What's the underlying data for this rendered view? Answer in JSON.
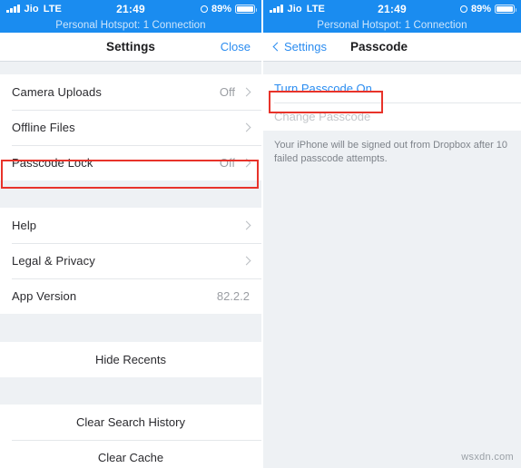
{
  "status_bar": {
    "carrier": "Jio",
    "network": "LTE",
    "time": "21:49",
    "battery_percent": "89%",
    "hotspot_text": "Personal Hotspot: 1 Connection",
    "background_color": "#1a8cf0",
    "icons": {
      "signal": "signal-bars-icon",
      "alarm": "alarm-clock-icon",
      "battery": "battery-icon"
    }
  },
  "left_panel": {
    "nav": {
      "title": "Settings",
      "action_label": "Close"
    },
    "groups": [
      {
        "name": "storage-group",
        "rows": [
          {
            "label": "Camera Uploads",
            "value": "Off",
            "chevron": true
          },
          {
            "label": "Offline Files",
            "value": "",
            "chevron": true
          },
          {
            "label": "Passcode Lock",
            "value": "Off",
            "chevron": true,
            "highlighted": true
          }
        ]
      },
      {
        "name": "info-group",
        "rows": [
          {
            "label": "Help",
            "value": "",
            "chevron": true
          },
          {
            "label": "Legal & Privacy",
            "value": "",
            "chevron": true
          },
          {
            "label": "App Version",
            "value": "82.2.2",
            "chevron": false
          }
        ]
      },
      {
        "name": "recents-group",
        "rows": [
          {
            "label": "Hide Recents",
            "centered": true
          }
        ]
      },
      {
        "name": "clear-group",
        "rows": [
          {
            "label": "Clear Search History",
            "centered": true
          },
          {
            "label": "Clear Cache",
            "centered": true
          }
        ]
      }
    ]
  },
  "right_panel": {
    "nav": {
      "back_label": "Settings",
      "title": "Passcode"
    },
    "rows": [
      {
        "label": "Turn Passcode On",
        "style": "blue",
        "highlighted": true
      },
      {
        "label": "Change Passcode",
        "style": "muted",
        "highlighted": false
      }
    ],
    "footer_note": "Your iPhone will be signed out from Dropbox after 10 failed passcode attempts."
  },
  "annotations": {
    "highlight_color": "#e8332a"
  },
  "watermark": "wsxdn.com"
}
